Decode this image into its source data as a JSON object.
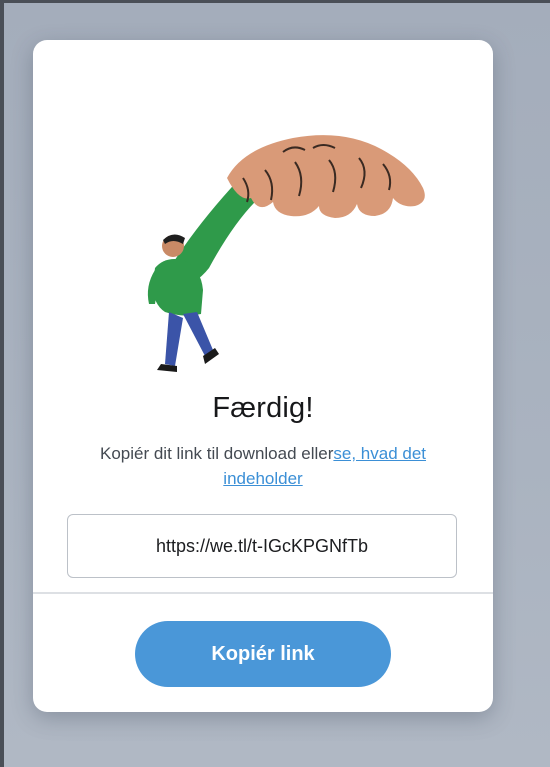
{
  "dialog": {
    "illustration_icon": "person-carried-by-giant-hand-illustration",
    "title": "Færdig!",
    "subtitle_text": "Kopiér dit link til download eller",
    "subtitle_link": "se, hvad det indeholder",
    "link_value": "https://we.tl/t-IGcKPGNfTb",
    "copy_button_label": "Kopiér link"
  },
  "colors": {
    "accent": "#4a97d8",
    "link": "#3b8fd6",
    "backdrop": "#a7b0be"
  }
}
